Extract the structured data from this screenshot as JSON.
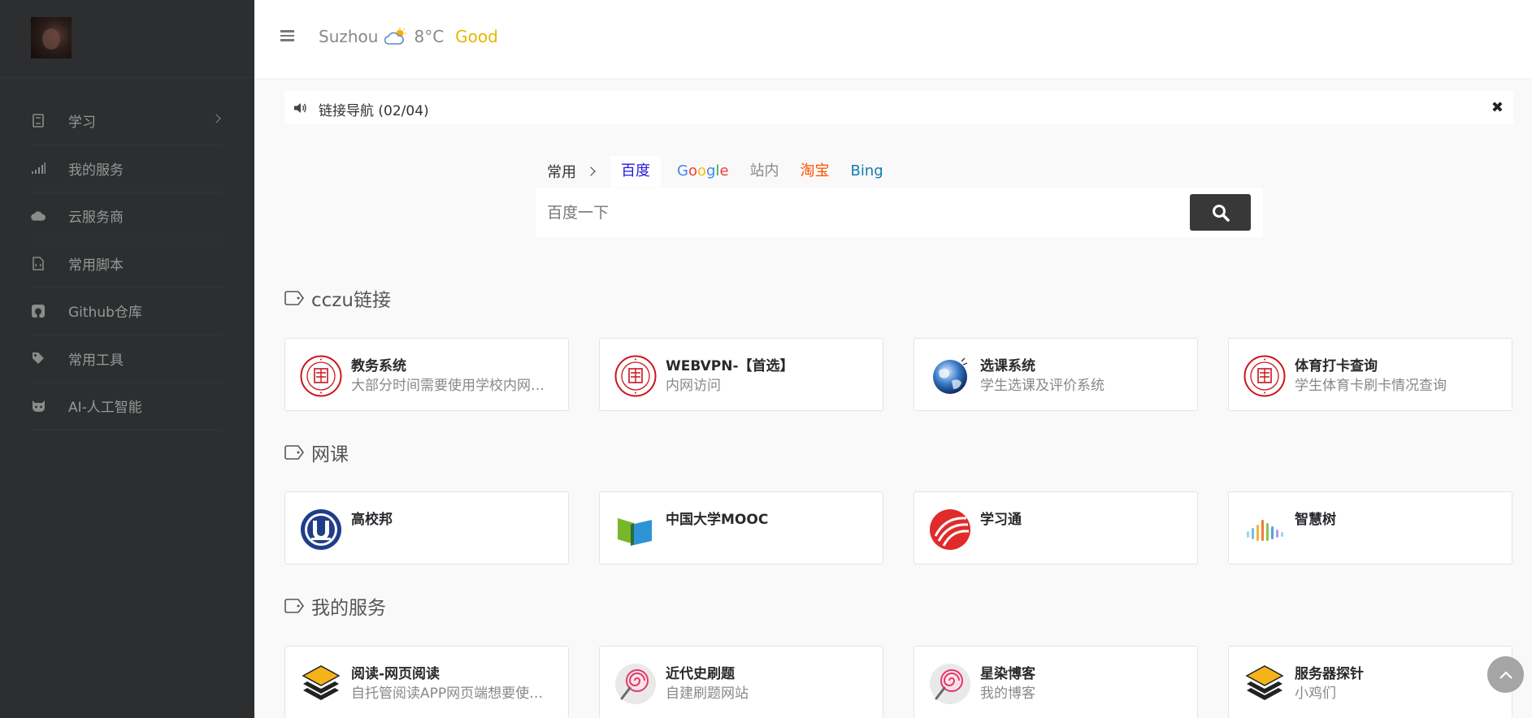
{
  "sidebar": {
    "items": [
      {
        "label": "学习",
        "icon": "book-icon"
      },
      {
        "label": "我的服务",
        "icon": "signal-bars-icon"
      },
      {
        "label": "云服务商",
        "icon": "cloud-icon"
      },
      {
        "label": "常用脚本",
        "icon": "script-file-icon"
      },
      {
        "label": "Github仓库",
        "icon": "github-icon"
      },
      {
        "label": "常用工具",
        "icon": "tag-icon"
      },
      {
        "label": "AI-人工智能",
        "icon": "github-cat-icon"
      }
    ]
  },
  "header": {
    "city": "Suzhou",
    "weather_icon": "partly-cloudy-icon",
    "temperature": "8°C",
    "air_quality": "Good",
    "air_quality_color": "#e6b800"
  },
  "notice": {
    "text": "链接导航 (02/04)",
    "close": "✖"
  },
  "search": {
    "group": "常用",
    "tabs": [
      {
        "label": "百度",
        "color": "#2319dc"
      },
      {
        "label": "Google",
        "color": "#4285f4"
      },
      {
        "label": "站内",
        "color": "#888888"
      },
      {
        "label": "淘宝",
        "color": "#ff5000"
      },
      {
        "label": "Bing",
        "color": "#0c7cb3"
      }
    ],
    "placeholder": "百度一下"
  },
  "sections": [
    {
      "title": "cczu链接",
      "cards": [
        {
          "title": "教务系统",
          "desc": "大部分时间需要使用学校内网或VPN访问",
          "logo": "cczu-seal"
        },
        {
          "title": "WEBVPN-【首选】",
          "desc": "内网访问",
          "logo": "cczu-seal"
        },
        {
          "title": "选课系统",
          "desc": "学生选课及评价系统",
          "logo": "globe"
        },
        {
          "title": "体育打卡查询",
          "desc": "学生体育卡刷卡情况查询",
          "logo": "cczu-seal"
        }
      ]
    },
    {
      "title": "网课",
      "cards": [
        {
          "title": "高校邦",
          "desc": "",
          "logo": "gaoxiaobang"
        },
        {
          "title": "中国大学MOOC",
          "desc": "",
          "logo": "mooc"
        },
        {
          "title": "学习通",
          "desc": "",
          "logo": "xuexitong"
        },
        {
          "title": "智慧树",
          "desc": "",
          "logo": "zhihuishu"
        }
      ]
    },
    {
      "title": "我的服务",
      "cards": [
        {
          "title": "阅读-网页阅读",
          "desc": "自托管阅读APP网页端想要使用请联系我",
          "logo": "layers"
        },
        {
          "title": "近代史刷题",
          "desc": "自建刷题网站",
          "logo": "lollipop"
        },
        {
          "title": "星染博客",
          "desc": "我的博客",
          "logo": "lollipop"
        },
        {
          "title": "服务器探针",
          "desc": "小鸡们",
          "logo": "layers"
        }
      ]
    }
  ]
}
